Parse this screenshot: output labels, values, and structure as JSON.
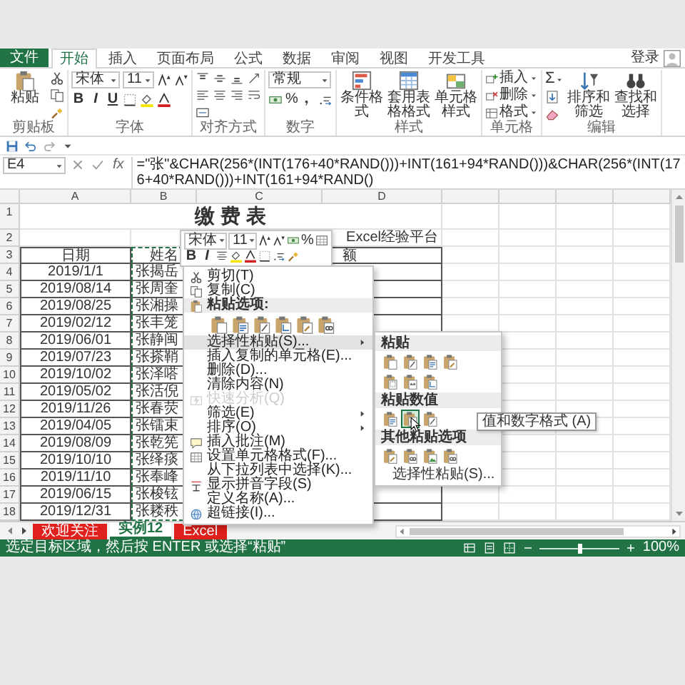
{
  "ribbon": {
    "file_tab": "文件",
    "account": "登录",
    "tabs": [
      {
        "label": "开始",
        "selected": true
      },
      {
        "label": "插入",
        "selected": false
      },
      {
        "label": "页面布局",
        "selected": false
      },
      {
        "label": "公式",
        "selected": false
      },
      {
        "label": "数据",
        "selected": false
      },
      {
        "label": "审阅",
        "selected": false
      },
      {
        "label": "视图",
        "selected": false
      },
      {
        "label": "开发工具",
        "selected": false
      }
    ],
    "groups": [
      {
        "kind": "clipboard",
        "title": "剪贴板",
        "paste": "粘贴"
      },
      {
        "kind": "font",
        "title": "字体",
        "font": "宋体",
        "size": "11",
        "bold": "B",
        "italic": "I",
        "underline": "U"
      },
      {
        "kind": "alignment",
        "title": "对齐方式"
      },
      {
        "kind": "number",
        "title": "数字",
        "format": "常规",
        "percent": "%"
      },
      {
        "kind": "styles",
        "title": "样式",
        "buttons": [
          "条件格式",
          "套用表格格式",
          "单元格样式"
        ]
      },
      {
        "kind": "cells",
        "title": "单元格",
        "buttons": [
          "插入",
          "删除",
          "格式"
        ]
      },
      {
        "kind": "editing",
        "title": "编辑",
        "sum": "Σ",
        "buttons": [
          "排序和筛选",
          "查找和选择"
        ]
      }
    ]
  },
  "formula_bar": {
    "name_box": "E4",
    "function_label": "fx",
    "formula": "=\"张\"&CHAR(256*(INT(176+40*RAND()))+INT(161+94*RAND()))&CHAR(256*(INT(176+40*RAND()))+INT(161+94*RAND()"
  },
  "sheet": {
    "columns": [
      "A",
      "B",
      "C",
      "D"
    ],
    "row_numbers": [
      "1",
      "2",
      "3",
      "4",
      "5",
      "6",
      "7",
      "8",
      "9",
      "10",
      "11",
      "12",
      "13",
      "14",
      "15",
      "16",
      "17",
      "18"
    ],
    "title": "缴 费 表",
    "note": "Excel经验平台",
    "header": {
      "date": "日期",
      "name": "姓名",
      "amount": "额"
    },
    "copy_marquee": true,
    "rows": [
      {
        "date": "2019/1/1",
        "name": "张揭岳"
      },
      {
        "date": "2019/08/14",
        "name": "张周奎"
      },
      {
        "date": "2019/08/25",
        "name": "张湘操"
      },
      {
        "date": "2019/02/12",
        "name": "张丰笼"
      },
      {
        "date": "2019/06/01",
        "name": "张静闽"
      },
      {
        "date": "2019/07/23",
        "name": "张搽鞘"
      },
      {
        "date": "2019/10/02",
        "name": "张泽嗒"
      },
      {
        "date": "2019/05/02",
        "name": "张活倪"
      },
      {
        "date": "2019/11/26",
        "name": "张春荧"
      },
      {
        "date": "2019/04/05",
        "name": "张镭束"
      },
      {
        "date": "2019/08/09",
        "name": "张乾筅"
      },
      {
        "date": "2019/10/10",
        "name": "张绎痰"
      },
      {
        "date": "2019/11/10",
        "name": "张奉峰"
      },
      {
        "date": "2019/06/15",
        "name": "张梭铉"
      },
      {
        "date": "2019/12/31",
        "name": "张耧秩"
      }
    ]
  },
  "mini_toolbar": {
    "font": "宋体",
    "size": "11",
    "percent": "%",
    "bold": "B",
    "italic": "I"
  },
  "context_menu": {
    "items": [
      {
        "kind": "cut",
        "label": "剪切(T)",
        "disabled": false,
        "highlighted": false,
        "submenu": false
      },
      {
        "kind": "copy",
        "label": "复制(C)",
        "disabled": false,
        "highlighted": false,
        "submenu": false
      },
      {
        "kind": "header",
        "label": "粘贴选项:",
        "disabled": false,
        "highlighted": false,
        "submenu": false
      },
      {
        "kind": "pastes",
        "icons": [
          {
            "kind": "paste"
          },
          {
            "kind": "values"
          },
          {
            "kind": "formulas"
          },
          {
            "kind": "transpose"
          },
          {
            "kind": "format"
          },
          {
            "kind": "link"
          }
        ],
        "disabled": false,
        "highlighted": false,
        "submenu": false
      },
      {
        "kind": "plain",
        "label": "选择性粘贴(S)...",
        "disabled": false,
        "highlighted": true,
        "submenu": true
      },
      {
        "kind": "plain",
        "label": "插入复制的单元格(E)...",
        "disabled": false,
        "highlighted": false,
        "submenu": false
      },
      {
        "kind": "plain",
        "label": "删除(D)...",
        "disabled": false,
        "highlighted": false,
        "submenu": false
      },
      {
        "kind": "plain",
        "label": "清除内容(N)",
        "disabled": false,
        "highlighted": false,
        "submenu": false
      },
      {
        "kind": "analysis",
        "label": "快速分析(Q)",
        "disabled": true,
        "highlighted": false,
        "submenu": false
      },
      {
        "kind": "plain",
        "label": "筛选(E)",
        "disabled": false,
        "highlighted": false,
        "submenu": true
      },
      {
        "kind": "plain",
        "label": "排序(O)",
        "disabled": false,
        "highlighted": false,
        "submenu": true
      },
      {
        "kind": "comment",
        "label": "插入批注(M)",
        "disabled": false,
        "highlighted": false,
        "submenu": false
      },
      {
        "kind": "cellformat",
        "label": "设置单元格格式(F)...",
        "disabled": false,
        "highlighted": false,
        "submenu": false
      },
      {
        "kind": "plain",
        "label": "从下拉列表中选择(K)...",
        "disabled": false,
        "highlighted": false,
        "submenu": false
      },
      {
        "kind": "pinyin",
        "label": "显示拼音字段(S)",
        "disabled": false,
        "highlighted": false,
        "submenu": false
      },
      {
        "kind": "plain",
        "label": "定义名称(A)...",
        "disabled": false,
        "highlighted": false,
        "submenu": false
      },
      {
        "kind": "hyperlink",
        "label": "超链接(I)...",
        "disabled": false,
        "highlighted": false,
        "submenu": false
      }
    ]
  },
  "paste_submenu": {
    "footer": "选择性粘贴(S)...",
    "tooltip": "值和数字格式 (A)",
    "sections": [
      {
        "title": "粘贴",
        "icons": [
          {
            "kind": "paste",
            "hovered": false
          },
          {
            "kind": "formulas",
            "hovered": false
          },
          {
            "kind": "values",
            "hovered": false
          },
          {
            "kind": "format",
            "hovered": false
          },
          {
            "kind": "borders",
            "hovered": false
          },
          {
            "kind": "widths",
            "hovered": false
          },
          {
            "kind": "transpose",
            "hovered": false
          }
        ]
      },
      {
        "title": "粘贴数值",
        "icons": [
          {
            "kind": "values",
            "hovered": false
          },
          {
            "kind": "widths",
            "hovered": true
          },
          {
            "kind": "formulas",
            "hovered": false
          }
        ]
      },
      {
        "title": "其他粘贴选项",
        "icons": [
          {
            "kind": "format",
            "hovered": false
          },
          {
            "kind": "link",
            "hovered": false
          },
          {
            "kind": "picture",
            "hovered": false
          },
          {
            "kind": "link",
            "hovered": false
          }
        ]
      }
    ]
  },
  "sheet_tabs": [
    {
      "label": "欢迎关注",
      "selected": false,
      "color": "#e0201c"
    },
    {
      "label": "实例12",
      "selected": true,
      "color": "#ffffff"
    },
    {
      "label": "Excel",
      "selected": false,
      "color": "#e0201c"
    }
  ],
  "status_bar": {
    "message": "选定目标区域，然后按 ENTER 或选择“粘贴”",
    "zoom": {
      "level": 0.5,
      "reading": "100%"
    }
  }
}
